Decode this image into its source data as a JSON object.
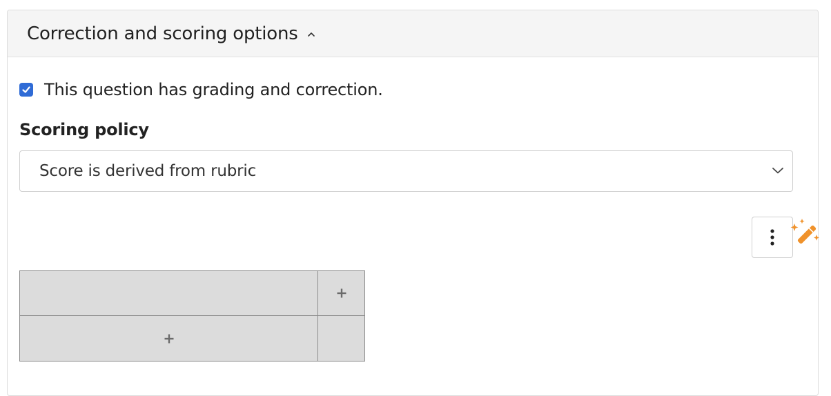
{
  "section": {
    "title": "Correction and scoring options",
    "expanded": true,
    "caret_icon": "caret-up-icon"
  },
  "grading_checkbox": {
    "checked": true,
    "label": "This question has grading and correction."
  },
  "scoring_policy": {
    "label": "Scoring policy",
    "selected_value": "Score is derived from rubric",
    "dropdown_icon": "chevron-down-icon"
  },
  "toolbar": {
    "more_icon": "vertical-ellipsis-icon",
    "magic_icon": "magic-wand-icon"
  },
  "rubric": {
    "add_column_icon": "plus-icon",
    "add_row_icon": "plus-icon"
  },
  "colors": {
    "accent_checkbox": "#2f6bd6",
    "magic_wand": "#f0922b",
    "grid_fill": "#dcdcdc",
    "grid_border": "#8a8a8a",
    "header_bg": "#f5f5f5"
  }
}
